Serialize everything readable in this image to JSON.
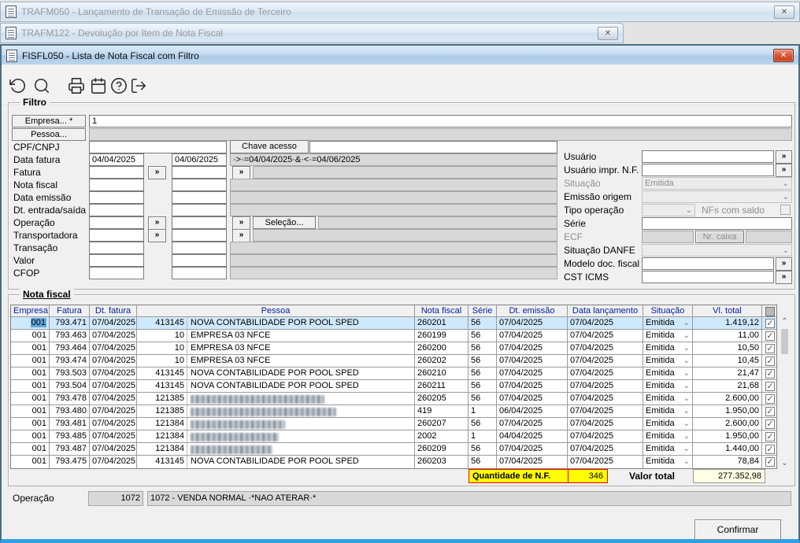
{
  "windows": {
    "background1": {
      "title": "TRAFM050 - Lançamento de Transação de Emissão de Terceiro"
    },
    "background2": {
      "title": "TRAFM122 - Devolução por Item de Nota Fiscal"
    },
    "main": {
      "title": "FISFL050 - Lista de Nota Fiscal com Filtro"
    }
  },
  "toolbar": {
    "icons": [
      "undo",
      "search",
      "print",
      "calendar",
      "help",
      "exit"
    ]
  },
  "filter": {
    "title": "Filtro",
    "empresa_button": "Empresa... *",
    "empresa_value": "1",
    "pessoa_button": "Pessoa...",
    "gg": "»",
    "left_rows": [
      {
        "label": "CPF/CNPJ",
        "kind": "cpf",
        "box_label": "Chave acesso"
      },
      {
        "label": "Data fatura",
        "kind": "dates",
        "a": "04/04/2025",
        "b": "04/06/2025",
        "expr": "·>·=04/04/2025·&·<·=04/06/2025"
      },
      {
        "label": "Fatura",
        "kind": "btns2"
      },
      {
        "label": "Nota fiscal",
        "kind": "plain"
      },
      {
        "label": "Data emissão",
        "kind": "plain"
      },
      {
        "label": "Dt. entrada/saída",
        "kind": "plain"
      },
      {
        "label": "Operação",
        "kind": "btns-selecao",
        "button": "Seleção..."
      },
      {
        "label": "Transportadora",
        "kind": "btns2"
      },
      {
        "label": "Transação",
        "kind": "plain"
      },
      {
        "label": "Valor",
        "kind": "plain"
      },
      {
        "label": "CFOP",
        "kind": "plain"
      }
    ],
    "right_rows": [
      {
        "label": "Usuário",
        "kind": "input-gg"
      },
      {
        "label": "Usuário impr. N.F.",
        "kind": "input-gg"
      },
      {
        "label": "Situação",
        "kind": "combo-disabled",
        "value": "Emitida",
        "disabled_label": true
      },
      {
        "label": "Emissão origem",
        "kind": "combo"
      },
      {
        "label": "Tipo operação",
        "kind": "tipo",
        "extra_label": "NFs com saldo"
      },
      {
        "label": "Série",
        "kind": "input-full"
      },
      {
        "label": "ECF",
        "kind": "ecf",
        "button": "Nr. caixa",
        "disabled_label": true
      },
      {
        "label": "Situação DANFE",
        "kind": "combo"
      },
      {
        "label": "Modelo doc. fiscal",
        "kind": "input-gg"
      },
      {
        "label": "CST ICMS",
        "kind": "input-gg"
      }
    ]
  },
  "table": {
    "title": "Nota fiscal",
    "columns": [
      "Empresa",
      "Fatura",
      "Dt. fatura",
      "Pessoa",
      "Nota fiscal",
      "Série",
      "Dt. emissão",
      "Data lançamento",
      "Situação",
      "Vl. total"
    ],
    "rows": [
      {
        "empresa": "001",
        "fatura": "793.471",
        "dt_fatura": "07/04/2025",
        "pessoa_code": "413145",
        "pessoa": "NOVA CONTABILIDADE POR POOL SPED",
        "nf": "260201",
        "serie": "56",
        "dt_emissao": "07/04/2025",
        "dt_lancamento": "07/04/2025",
        "situacao": "Emitida",
        "vl_total": "1.419,12",
        "checked": true,
        "selected": true
      },
      {
        "empresa": "001",
        "fatura": "793.463",
        "dt_fatura": "07/04/2025",
        "pessoa_code": "10",
        "pessoa": "EMPRESA 03 NFCE",
        "nf": "260199",
        "serie": "56",
        "dt_emissao": "07/04/2025",
        "dt_lancamento": "07/04/2025",
        "situacao": "Emitida",
        "vl_total": "11,00",
        "checked": true
      },
      {
        "empresa": "001",
        "fatura": "793.464",
        "dt_fatura": "07/04/2025",
        "pessoa_code": "10",
        "pessoa": "EMPRESA 03 NFCE",
        "nf": "260200",
        "serie": "56",
        "dt_emissao": "07/04/2025",
        "dt_lancamento": "07/04/2025",
        "situacao": "Emitida",
        "vl_total": "10,50",
        "checked": true
      },
      {
        "empresa": "001",
        "fatura": "793.474",
        "dt_fatura": "07/04/2025",
        "pessoa_code": "10",
        "pessoa": "EMPRESA 03 NFCE",
        "nf": "260202",
        "serie": "56",
        "dt_emissao": "07/04/2025",
        "dt_lancamento": "07/04/2025",
        "situacao": "Emitida",
        "vl_total": "10,45",
        "checked": true
      },
      {
        "empresa": "001",
        "fatura": "793.503",
        "dt_fatura": "07/04/2025",
        "pessoa_code": "413145",
        "pessoa": "NOVA CONTABILIDADE POR POOL SPED",
        "nf": "260210",
        "serie": "56",
        "dt_emissao": "07/04/2025",
        "dt_lancamento": "07/04/2025",
        "situacao": "Emitida",
        "vl_total": "21,47",
        "checked": true
      },
      {
        "empresa": "001",
        "fatura": "793.504",
        "dt_fatura": "07/04/2025",
        "pessoa_code": "413145",
        "pessoa": "NOVA CONTABILIDADE POR POOL SPED",
        "nf": "260211",
        "serie": "56",
        "dt_emissao": "07/04/2025",
        "dt_lancamento": "07/04/2025",
        "situacao": "Emitida",
        "vl_total": "21,68",
        "checked": true
      },
      {
        "empresa": "001",
        "fatura": "793.478",
        "dt_fatura": "07/04/2025",
        "pessoa_code": "121385",
        "pessoa": null,
        "redacted": true,
        "redact_width": 170,
        "nf": "260205",
        "serie": "56",
        "dt_emissao": "07/04/2025",
        "dt_lancamento": "07/04/2025",
        "situacao": "Emitida",
        "vl_total": "2.600,00",
        "checked": true
      },
      {
        "empresa": "001",
        "fatura": "793.480",
        "dt_fatura": "07/04/2025",
        "pessoa_code": "121385",
        "pessoa": null,
        "redacted": true,
        "redact_width": 185,
        "nf": "419",
        "serie": "1",
        "dt_emissao": "06/04/2025",
        "dt_lancamento": "07/04/2025",
        "situacao": "Emitida",
        "vl_total": "1.950,00",
        "checked": true
      },
      {
        "empresa": "001",
        "fatura": "793.481",
        "dt_fatura": "07/04/2025",
        "pessoa_code": "121384",
        "pessoa": null,
        "redacted": true,
        "redact_width": 120,
        "nf": "260207",
        "serie": "56",
        "dt_emissao": "07/04/2025",
        "dt_lancamento": "07/04/2025",
        "situacao": "Emitida",
        "vl_total": "2.600,00",
        "checked": true
      },
      {
        "empresa": "001",
        "fatura": "793.485",
        "dt_fatura": "07/04/2025",
        "pessoa_code": "121384",
        "pessoa": null,
        "redacted": true,
        "redact_width": 112,
        "nf": "2002",
        "serie": "1",
        "dt_emissao": "04/04/2025",
        "dt_lancamento": "07/04/2025",
        "situacao": "Emitida",
        "vl_total": "1.950,00",
        "checked": true
      },
      {
        "empresa": "001",
        "fatura": "793.487",
        "dt_fatura": "07/04/2025",
        "pessoa_code": "121384",
        "pessoa": null,
        "redacted": true,
        "redact_width": 104,
        "nf": "260209",
        "serie": "56",
        "dt_emissao": "07/04/2025",
        "dt_lancamento": "07/04/2025",
        "situacao": "Emitida",
        "vl_total": "1.440,00",
        "checked": true
      },
      {
        "empresa": "001",
        "fatura": "793.475",
        "dt_fatura": "07/04/2025",
        "pessoa_code": "413145",
        "pessoa": "NOVA CONTABILIDADE POR POOL SPED",
        "nf": "260203",
        "serie": "56",
        "dt_emissao": "07/04/2025",
        "dt_lancamento": "07/04/2025",
        "situacao": "Emitida",
        "vl_total": "78,84",
        "checked": true
      }
    ],
    "footer": {
      "qty_label": "Quantidade de N.F.",
      "qty_value": "346",
      "total_label": "Valor total",
      "total_value": "277.352,98"
    }
  },
  "footer_bar": {
    "operacao_label": "Operação",
    "operacao_code": "1072",
    "operacao_desc": "1072 - VENDA NORMAL ·*NAO ATERAR·*",
    "confirm_button": "Confirmar"
  },
  "colors": {
    "accent_title": "#abc9e6",
    "selected_row": "#cfe9fc",
    "qty_bg": "#ffff00",
    "qty_border": "#ff0000",
    "total_bg": "#ffffe6",
    "header_text": "#001f9c"
  }
}
